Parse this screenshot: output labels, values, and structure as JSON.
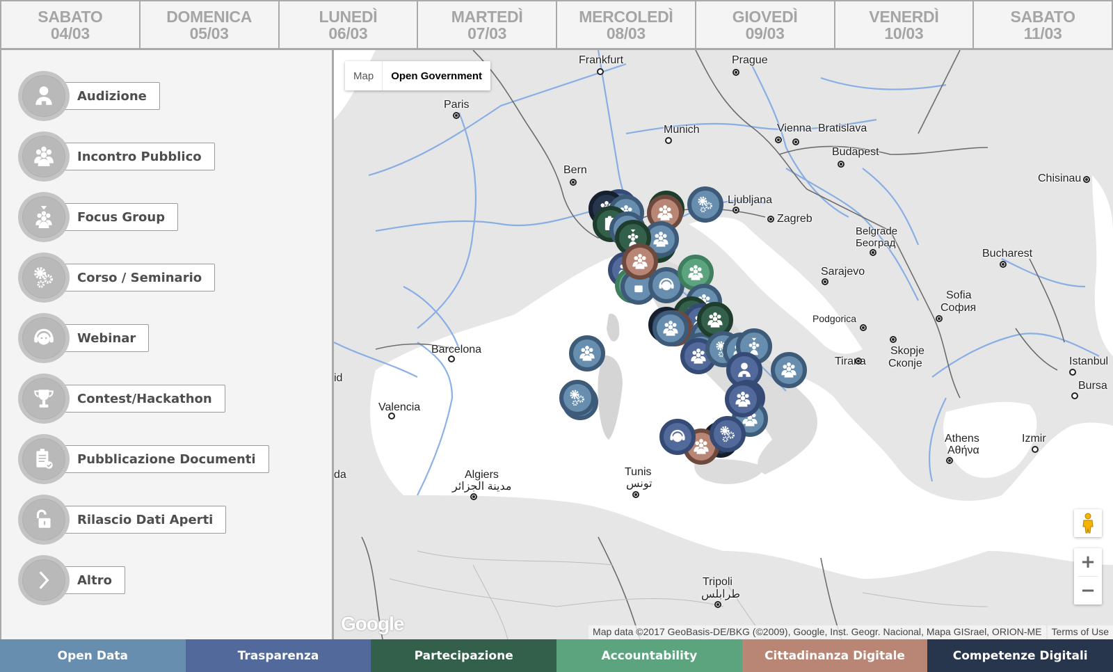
{
  "days": [
    {
      "name": "SABATO",
      "date": "04/03"
    },
    {
      "name": "DOMENICA",
      "date": "05/03"
    },
    {
      "name": "LUNEDÌ",
      "date": "06/03"
    },
    {
      "name": "MARTEDÌ",
      "date": "07/03"
    },
    {
      "name": "MERCOLEDÌ",
      "date": "08/03"
    },
    {
      "name": "GIOVEDÌ",
      "date": "09/03"
    },
    {
      "name": "VENERDÌ",
      "date": "10/03"
    },
    {
      "name": "SABATO",
      "date": "11/03"
    }
  ],
  "legend": [
    {
      "label": "Audizione",
      "icon": "person-icon"
    },
    {
      "label": "Incontro Pubblico",
      "icon": "group-icon"
    },
    {
      "label": "Focus Group",
      "icon": "focus-group-icon"
    },
    {
      "label": "Corso / Seminario",
      "icon": "gears-icon"
    },
    {
      "label": "Webinar",
      "icon": "headset-icon"
    },
    {
      "label": "Contest/Hackathon",
      "icon": "trophy-icon"
    },
    {
      "label": "Pubblicazione Documenti",
      "icon": "clipboard-check-icon"
    },
    {
      "label": "Rilascio Dati Aperti",
      "icon": "unlock-icon"
    },
    {
      "label": "Altro",
      "icon": "chevron-right-icon"
    }
  ],
  "map": {
    "type_controls": {
      "map": "Map",
      "open_government": "Open Government"
    },
    "zoom_in": "+",
    "zoom_out": "−",
    "logo": "Google",
    "attribution": "Map data ©2017 GeoBasis-DE/BKG (©2009), Google, Inst. Geogr. Nacional, Mapa GISrael, ORION-ME",
    "terms": "Terms of Use",
    "cities": [
      {
        "name": "Frankfurt"
      },
      {
        "name": "Prague"
      },
      {
        "name": "Paris"
      },
      {
        "name": "Munich"
      },
      {
        "name": "Vienna"
      },
      {
        "name": "Bratislava"
      },
      {
        "name": "Budapest"
      },
      {
        "name": "Bern"
      },
      {
        "name": "Chisinau"
      },
      {
        "name": "Ljubljana"
      },
      {
        "name": "Zagreb"
      },
      {
        "name": "Belgrade"
      },
      {
        "name": "Београд"
      },
      {
        "name": "Bucharest"
      },
      {
        "name": "Sarajevo"
      },
      {
        "name": "Sofia"
      },
      {
        "name": "София"
      },
      {
        "name": "Podgorica"
      },
      {
        "name": "Barcelona"
      },
      {
        "name": "Skopje"
      },
      {
        "name": "Скопје"
      },
      {
        "name": "Tirana"
      },
      {
        "name": "Istanbul"
      },
      {
        "name": "Bursa"
      },
      {
        "name": "Valencia"
      },
      {
        "name": "Athens"
      },
      {
        "name": "Αθήνα"
      },
      {
        "name": "Izmir"
      },
      {
        "name": "Algiers"
      },
      {
        "name": "مدينة الجزائر"
      },
      {
        "name": "Tunis"
      },
      {
        "name": "تونس"
      },
      {
        "name": "Tripoli"
      },
      {
        "name": "طرابلس"
      },
      {
        "name": "id"
      },
      {
        "name": "da"
      }
    ]
  },
  "categories": [
    {
      "label": "Open Data",
      "color": "#678daf"
    },
    {
      "label": "Trasparenza",
      "color": "#526a9b"
    },
    {
      "label": "Partecipazione",
      "color": "#33604a"
    },
    {
      "label": "Accountability",
      "color": "#5ba47e"
    },
    {
      "label": "Cittadinanza Digitale",
      "color": "#b98676"
    },
    {
      "label": "Competenze Digitali",
      "color": "#27354d"
    }
  ]
}
